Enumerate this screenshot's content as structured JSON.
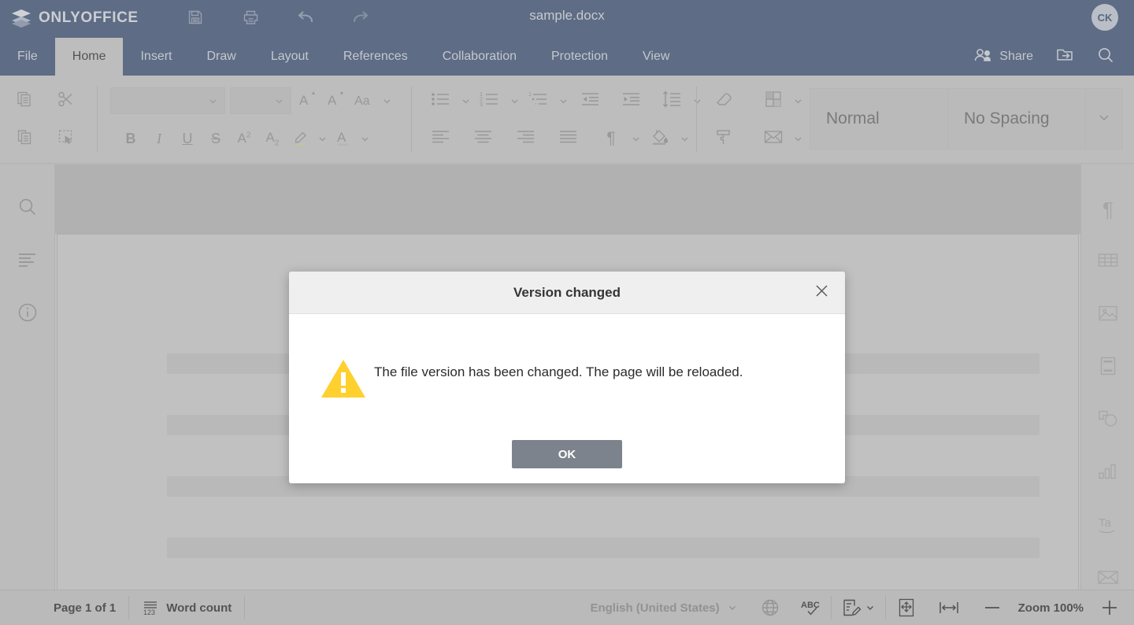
{
  "app": {
    "brand": "ONLYOFFICE",
    "document_title": "sample.docx",
    "user_initials": "CK",
    "header_color": "#42567a",
    "toolbar_color": "#cbcbcb"
  },
  "quick_access": [
    {
      "name": "save-button",
      "icon": "save-icon"
    },
    {
      "name": "print-button",
      "icon": "print-icon"
    },
    {
      "name": "undo-button",
      "icon": "undo-icon"
    },
    {
      "name": "redo-button",
      "icon": "redo-icon"
    }
  ],
  "tabs": [
    {
      "label": "File",
      "active": false
    },
    {
      "label": "Home",
      "active": true
    },
    {
      "label": "Insert",
      "active": false
    },
    {
      "label": "Draw",
      "active": false
    },
    {
      "label": "Layout",
      "active": false
    },
    {
      "label": "References",
      "active": false
    },
    {
      "label": "Collaboration",
      "active": false
    },
    {
      "label": "Protection",
      "active": false
    },
    {
      "label": "View",
      "active": false
    }
  ],
  "header_actions": {
    "share_label": "Share",
    "share_icon": "users-icon",
    "open_location_icon": "open-file-location-icon",
    "search_icon": "search-icon"
  },
  "toolbar": {
    "clipboard": [
      {
        "name": "copy-button",
        "icon": "copy-icon"
      },
      {
        "name": "cut-button",
        "icon": "scissors-icon"
      },
      {
        "name": "paste-button",
        "icon": "paste-icon"
      },
      {
        "name": "select-all-button",
        "icon": "select-tool-icon"
      }
    ],
    "font_name_value": "",
    "font_name_placeholder": "",
    "font_size_value": "",
    "font_size_placeholder": "",
    "font_buttons": [
      {
        "name": "increase-font-size-button",
        "icon": "increase-font-icon"
      },
      {
        "name": "decrease-font-size-button",
        "icon": "decrease-font-icon"
      },
      {
        "name": "change-case-button",
        "icon": "change-case-icon"
      }
    ],
    "format_buttons": [
      {
        "name": "bold-button",
        "icon": "bold-icon",
        "glyph": "B"
      },
      {
        "name": "italic-button",
        "icon": "italic-icon",
        "glyph": "I"
      },
      {
        "name": "underline-button",
        "icon": "underline-icon",
        "glyph": "U"
      },
      {
        "name": "strikethrough-button",
        "icon": "strikethrough-icon",
        "glyph": "S"
      },
      {
        "name": "superscript-button",
        "icon": "superscript-icon",
        "glyph": "A²"
      },
      {
        "name": "subscript-button",
        "icon": "subscript-icon",
        "glyph": "A₂"
      },
      {
        "name": "highlight-color-button",
        "icon": "highlighter-icon"
      },
      {
        "name": "font-color-button",
        "icon": "font-color-icon"
      }
    ],
    "paragraph_row1": [
      {
        "name": "bullets-button",
        "icon": "bullet-list-icon"
      },
      {
        "name": "numbering-button",
        "icon": "numbered-list-icon"
      },
      {
        "name": "multilevel-list-button",
        "icon": "multilevel-list-icon"
      },
      {
        "name": "decrease-indent-button",
        "icon": "decrease-indent-icon"
      },
      {
        "name": "increase-indent-button",
        "icon": "increase-indent-icon"
      },
      {
        "name": "line-spacing-button",
        "icon": "line-spacing-icon"
      }
    ],
    "paragraph_row2": [
      {
        "name": "align-left-button",
        "icon": "align-left-icon"
      },
      {
        "name": "align-center-button",
        "icon": "align-center-icon"
      },
      {
        "name": "align-right-button",
        "icon": "align-right-icon"
      },
      {
        "name": "align-justify-button",
        "icon": "align-justify-icon"
      },
      {
        "name": "show-formatting-marks-button",
        "icon": "pilcrow-icon"
      },
      {
        "name": "shading-button",
        "icon": "paint-bucket-icon"
      }
    ],
    "extra_row1": [
      {
        "name": "clear-style-button",
        "icon": "eraser-icon"
      },
      {
        "name": "borders-button",
        "icon": "borders-icon"
      }
    ],
    "extra_row2": [
      {
        "name": "copy-style-button",
        "icon": "format-painter-icon"
      },
      {
        "name": "mail-merge-button",
        "icon": "envelope-icon"
      }
    ],
    "styles": [
      {
        "label": "Normal"
      },
      {
        "label": "No Spacing"
      }
    ],
    "styles_more_icon": "chevron-down-icon"
  },
  "left_panel": [
    {
      "name": "sidebar-item-search",
      "icon": "search-icon"
    },
    {
      "name": "sidebar-item-navigation",
      "icon": "headings-icon"
    },
    {
      "name": "sidebar-item-about",
      "icon": "info-icon"
    }
  ],
  "right_panel": [
    {
      "name": "sidebar-item-paragraph-settings",
      "icon": "pilcrow-icon"
    },
    {
      "name": "sidebar-item-table-settings",
      "icon": "table-icon"
    },
    {
      "name": "sidebar-item-image-settings",
      "icon": "image-icon"
    },
    {
      "name": "sidebar-item-header-footer-settings",
      "icon": "textbox-icon"
    },
    {
      "name": "sidebar-item-shape-settings",
      "icon": "shape-icon"
    },
    {
      "name": "sidebar-item-chart-settings",
      "icon": "chart-icon"
    },
    {
      "name": "sidebar-item-text-art-settings",
      "icon": "text-art-icon"
    },
    {
      "name": "sidebar-item-mail-merge-settings",
      "icon": "envelope-icon"
    }
  ],
  "document": {
    "skeleton_rows": 4
  },
  "status_bar": {
    "page_label": "Page 1 of 1",
    "word_count_label": "Word count",
    "word_count_icon": "word-count-icon",
    "language_label": "English (United States)",
    "language_caret_icon": "chevron-down-icon",
    "set_language_icon": "globe-icon",
    "spell_check_icon": "spell-check-icon",
    "track_changes_icon": "track-changes-icon",
    "fit_page_icon": "fit-to-page-icon",
    "fit_width_icon": "fit-to-width-icon",
    "zoom_out_icon": "minus-icon",
    "zoom_label": "Zoom 100%",
    "zoom_in_icon": "plus-icon"
  },
  "modal": {
    "title": "Version changed",
    "close_icon": "close-icon",
    "warning_icon": "warning-triangle-icon",
    "message": "The file version has been changed. The page will be reloaded.",
    "ok_label": "OK",
    "ok_color": "#7c838c",
    "warning_color": "#ffd02e"
  }
}
